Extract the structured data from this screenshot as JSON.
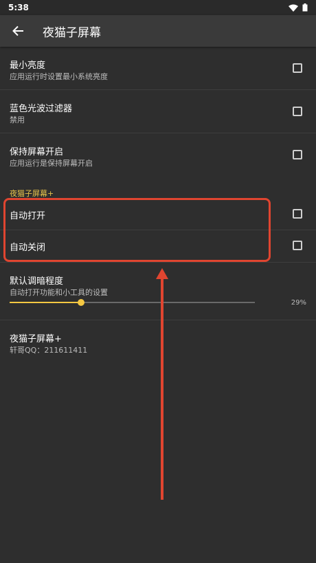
{
  "status_bar": {
    "time": "5:38"
  },
  "toolbar": {
    "title": "夜猫子屏幕"
  },
  "settings": [
    {
      "title": "最小亮度",
      "subtitle": "应用运行时设置最小系统亮度",
      "checked": false
    },
    {
      "title": "蓝色光波过滤器",
      "subtitle": "禁用",
      "checked": false
    },
    {
      "title": "保持屏幕开启",
      "subtitle": "应用运行是保持屏幕开启",
      "checked": false
    }
  ],
  "category": {
    "label": "夜猫子屏幕+"
  },
  "plus_settings": [
    {
      "title": "自动打开",
      "checked": false
    },
    {
      "title": "自动关闭",
      "checked": false
    }
  ],
  "dim_setting": {
    "title": "默认调暗程度",
    "subtitle": "自动打开功能和小工具的设置",
    "value": 29,
    "value_label": "29%"
  },
  "about": {
    "title": "夜猫子屏幕+",
    "subtitle": "轩哥QQ：211611411"
  },
  "colors": {
    "background": "#2e2e2e",
    "toolbar": "#3a3a3a",
    "accent": "#f5c842",
    "category": "#e6c34a",
    "annotation": "#e04530"
  }
}
